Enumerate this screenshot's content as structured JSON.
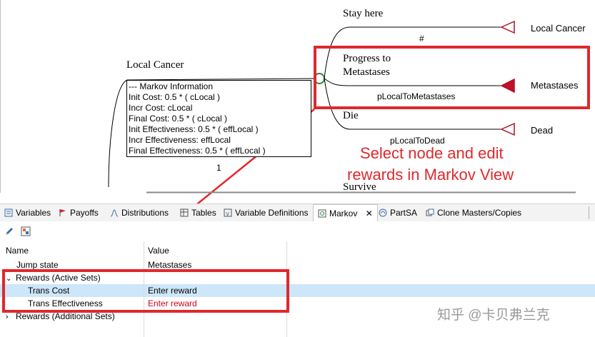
{
  "tree": {
    "parent_node_label": "Local Cancer",
    "markov_info": {
      "header": "--- Markov Information",
      "lines": [
        "Init Cost: 0.5 * ( cLocal )",
        "Incr Cost: cLocal",
        "Final Cost: 0.5 * ( cLocal )",
        "Init Effectiveness: 0.5 * ( effLocal )",
        "Incr Effectiveness: effLocal",
        "Final Effectiveness: 0.5 * ( effLocal )"
      ]
    },
    "branch_number": "1",
    "branches": [
      {
        "label": "Stay here",
        "prob": "#",
        "terminal": "Local Cancer"
      },
      {
        "label": "Progress to\nMetastases",
        "prob": "pLocalToMetastases",
        "terminal": "Metastases"
      },
      {
        "label": "Die",
        "prob": "pLocalToDead",
        "terminal": "Dead"
      }
    ],
    "partial_label": "Survive"
  },
  "annotation": {
    "line1": "Select node and edit",
    "line2": "rewards in Markov View",
    "color": "#e0282c"
  },
  "tabs": [
    {
      "label": "Variables",
      "icon": "variables-icon"
    },
    {
      "label": "Payoffs",
      "icon": "payoffs-icon"
    },
    {
      "label": "Distributions",
      "icon": "distributions-icon"
    },
    {
      "label": "Tables",
      "icon": "tables-icon"
    },
    {
      "label": "Variable Definitions",
      "icon": "variable-definitions-icon"
    },
    {
      "label": "Markov",
      "icon": "markov-icon",
      "active": true
    },
    {
      "label": "PartSA",
      "icon": "partsa-icon"
    },
    {
      "label": "Clone Masters/Copies",
      "icon": "clone-masters-icon"
    }
  ],
  "properties": {
    "header_name": "Name",
    "header_value": "Value",
    "rows": [
      {
        "name": "Jump state",
        "value": "Metastases"
      },
      {
        "name": "Rewards (Active Sets)",
        "value": "",
        "expanded": true
      },
      {
        "name": "Trans Cost",
        "value": "Enter reward",
        "selected": true
      },
      {
        "name": "Trans Effectiveness",
        "value": "Enter reward",
        "value_color": "#d0021b"
      },
      {
        "name": "Rewards (Additional Sets)",
        "value": "",
        "expanded": false
      }
    ]
  },
  "watermark": "知乎 @卡贝弗兰克"
}
